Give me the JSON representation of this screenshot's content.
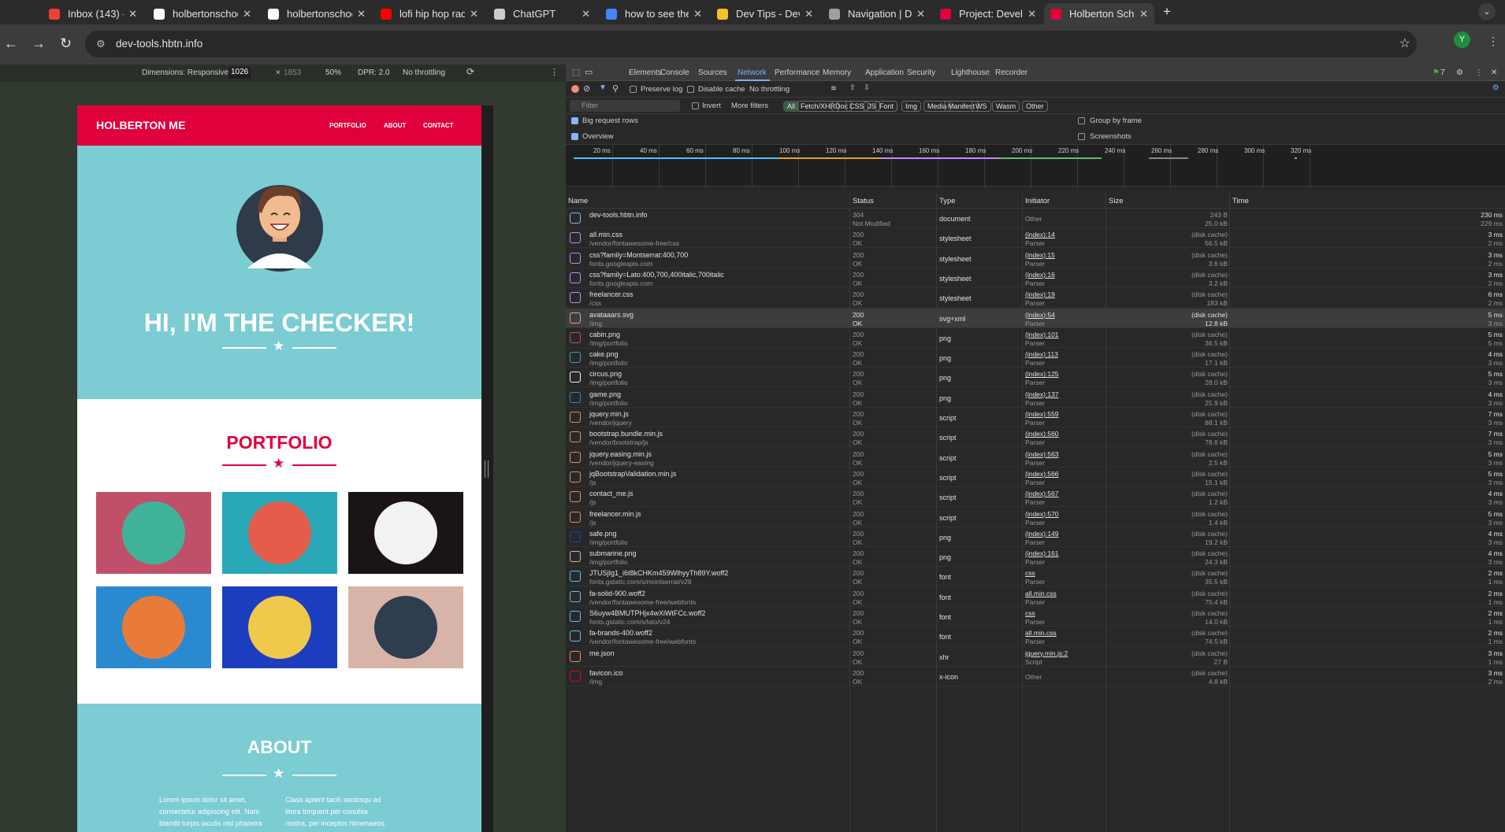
{
  "tabs": [
    {
      "title": "Inbox (143) - 630",
      "color": "#ea4335",
      "active": false
    },
    {
      "title": "holbertonschool-w",
      "color": "#ffffff",
      "active": false
    },
    {
      "title": "holbertonschool-v",
      "color": "#ffffff",
      "active": false
    },
    {
      "title": "lofi hip hop radio",
      "color": "#ff0000",
      "active": false
    },
    {
      "title": "ChatGPT",
      "color": "#cccccc",
      "active": false
    },
    {
      "title": "how to see the we",
      "color": "#4285f4",
      "active": false
    },
    {
      "title": "Dev Tips - Develo",
      "color": "#f6c026",
      "active": false
    },
    {
      "title": "Navigation | Dow",
      "color": "#9aa0a6",
      "active": false
    },
    {
      "title": "Project: Develope",
      "color": "#e0003c",
      "active": false
    },
    {
      "title": "Holberton School",
      "color": "#e0003c",
      "active": true
    }
  ],
  "address": "dev-tools.hbtn.info",
  "profile_initial": "Y",
  "device_toolbar": {
    "dimensions": "Dimensions: Responsive",
    "width": "1026",
    "times": "×",
    "height": "1853",
    "zoom": "50%",
    "dpr": "DPR: 2.0",
    "throttling": "No throttling"
  },
  "site": {
    "brand": "HOLBERTON ME",
    "nav": [
      "PORTFOLIO",
      "ABOUT",
      "CONTACT"
    ],
    "hero_title": "HI, I'M THE CHECKER!",
    "portfolio_title": "PORTFOLIO",
    "about_title": "ABOUT",
    "about_left": [
      "Lorem ipsum dolor sit amet,",
      "consectetur adipiscing elit. Nam",
      "blandit turpis iaculis nisl pharetra"
    ],
    "about_right": [
      "Class aptent taciti sociosqu ad",
      "litora torquent per conubia",
      "nostra, per inceptos himenaeos."
    ],
    "tiles": [
      {
        "name": "cabin",
        "bg": "#c0506a",
        "circle": "#3fb39a"
      },
      {
        "name": "cake",
        "bg": "#2aa8b8",
        "circle": "#e35d4a"
      },
      {
        "name": "circus",
        "bg": "#1a1414",
        "circle": "#f2f2f2"
      },
      {
        "name": "game",
        "bg": "#2a8ad0",
        "circle": "#e87b3a"
      },
      {
        "name": "safe",
        "bg": "#1d3fbf",
        "circle": "#f0c84b"
      },
      {
        "name": "submarine",
        "bg": "#d8b4a8",
        "circle": "#2c3e50"
      }
    ]
  },
  "devtools": {
    "panels": [
      "Elements",
      "Console",
      "Sources",
      "Network",
      "Performance",
      "Memory",
      "Application",
      "Security",
      "Lighthouse",
      "Recorder"
    ],
    "active_panel": "Network",
    "issues_count": "7",
    "preserve_log": "Preserve log",
    "disable_cache": "Disable cache",
    "throttle": "No throttling",
    "filter_placeholder": "Filter",
    "invert": "Invert",
    "more_filters": "More filters",
    "filter_chips": [
      "All",
      "Fetch/XHR",
      "Doc",
      "CSS",
      "JS",
      "Font",
      "Img",
      "Media",
      "Manifest",
      "WS",
      "Wasm",
      "Other"
    ],
    "big_request_rows": "Big request rows",
    "overview": "Overview",
    "group_by_frame": "Group by frame",
    "screenshots": "Screenshots",
    "ticks": [
      "20 ms",
      "40 ms",
      "60 ms",
      "80 ms",
      "100 ms",
      "120 ms",
      "140 ms",
      "160 ms",
      "180 ms",
      "200 ms",
      "220 ms",
      "240 ms",
      "260 ms",
      "280 ms",
      "300 ms",
      "320 ms"
    ],
    "columns": [
      "Name",
      "Status",
      "Type",
      "Initiator",
      "Size",
      "Time"
    ],
    "requests": [
      {
        "name": "dev-tools.hbtn.info",
        "path": "",
        "status": "304",
        "status_text": "Not Modified",
        "type": "document",
        "initiator": "Other",
        "init2": "",
        "size": "243 B",
        "size2": "25.0 kB",
        "time": "230 ms",
        "time2": "229 ms",
        "icon": "#8ab4f8"
      },
      {
        "name": "all.min.css",
        "path": "/vendor/fontawesome-free/css",
        "status": "200",
        "status_text": "OK",
        "type": "stylesheet",
        "initiator": "(index):14",
        "init2": "Parser",
        "size": "(disk cache)",
        "size2": "56.5 kB",
        "time": "3 ms",
        "time2": "2 ms",
        "icon": "#c58af9"
      },
      {
        "name": "css?family=Montserrat:400,700",
        "path": "fonts.googleapis.com",
        "status": "200",
        "status_text": "OK",
        "type": "stylesheet",
        "initiator": "(index):15",
        "init2": "Parser",
        "size": "(disk cache)",
        "size2": "3.6 kB",
        "time": "3 ms",
        "time2": "2 ms",
        "icon": "#c58af9"
      },
      {
        "name": "css?family=Lato:400,700,400italic,700italic",
        "path": "fonts.googleapis.com",
        "status": "200",
        "status_text": "OK",
        "type": "stylesheet",
        "initiator": "(index):16",
        "init2": "Parser",
        "size": "(disk cache)",
        "size2": "3.2 kB",
        "time": "3 ms",
        "time2": "2 ms",
        "icon": "#c58af9"
      },
      {
        "name": "freelancer.css",
        "path": "/css",
        "status": "200",
        "status_text": "OK",
        "type": "stylesheet",
        "initiator": "(index):19",
        "init2": "Parser",
        "size": "(disk cache)",
        "size2": "183 kB",
        "time": "6 ms",
        "time2": "2 ms",
        "icon": "#c58af9"
      },
      {
        "name": "avataaars.svg",
        "path": "/img",
        "status": "200",
        "status_text": "OK",
        "type": "svg+xml",
        "initiator": "(index):54",
        "init2": "Parser",
        "size": "(disk cache)",
        "size2": "12.8 kB",
        "time": "5 ms",
        "time2": "3 ms",
        "icon": "#e8a97c",
        "highlight": true
      },
      {
        "name": "cabin.png",
        "path": "/img/portfolio",
        "status": "200",
        "status_text": "OK",
        "type": "png",
        "initiator": "(index):101",
        "init2": "Parser",
        "size": "(disk cache)",
        "size2": "36.5 kB",
        "time": "5 ms",
        "time2": "5 ms",
        "icon": "#c0506a"
      },
      {
        "name": "cake.png",
        "path": "/img/portfolio",
        "status": "200",
        "status_text": "OK",
        "type": "png",
        "initiator": "(index):113",
        "init2": "Parser",
        "size": "(disk cache)",
        "size2": "17.1 kB",
        "time": "4 ms",
        "time2": "3 ms",
        "icon": "#2aa8b8"
      },
      {
        "name": "circus.png",
        "path": "/img/portfolio",
        "status": "200",
        "status_text": "OK",
        "type": "png",
        "initiator": "(index):125",
        "init2": "Parser",
        "size": "(disk cache)",
        "size2": "28.0 kB",
        "time": "5 ms",
        "time2": "3 ms",
        "icon": "#f2f2f2"
      },
      {
        "name": "game.png",
        "path": "/img/portfolio",
        "status": "200",
        "status_text": "OK",
        "type": "png",
        "initiator": "(index):137",
        "init2": "Parser",
        "size": "(disk cache)",
        "size2": "25.9 kB",
        "time": "4 ms",
        "time2": "3 ms",
        "icon": "#2a8ad0"
      },
      {
        "name": "jquery.min.js",
        "path": "/vendor/jquery",
        "status": "200",
        "status_text": "OK",
        "type": "script",
        "initiator": "(index):559",
        "init2": "Parser",
        "size": "(disk cache)",
        "size2": "88.1 kB",
        "time": "7 ms",
        "time2": "3 ms",
        "icon": "#ee8a5a"
      },
      {
        "name": "bootstrap.bundle.min.js",
        "path": "/vendor/bootstrap/js",
        "status": "200",
        "status_text": "OK",
        "type": "script",
        "initiator": "(index):560",
        "init2": "Parser",
        "size": "(disk cache)",
        "size2": "78.6 kB",
        "time": "7 ms",
        "time2": "3 ms",
        "icon": "#ee8a5a"
      },
      {
        "name": "jquery.easing.min.js",
        "path": "/vendor/jquery-easing",
        "status": "200",
        "status_text": "OK",
        "type": "script",
        "initiator": "(index):563",
        "init2": "Parser",
        "size": "(disk cache)",
        "size2": "2.5 kB",
        "time": "5 ms",
        "time2": "3 ms",
        "icon": "#ee8a5a"
      },
      {
        "name": "jqBootstrapValidation.min.js",
        "path": "/js",
        "status": "200",
        "status_text": "OK",
        "type": "script",
        "initiator": "(index):566",
        "init2": "Parser",
        "size": "(disk cache)",
        "size2": "15.1 kB",
        "time": "5 ms",
        "time2": "3 ms",
        "icon": "#ee8a5a"
      },
      {
        "name": "contact_me.js",
        "path": "/js",
        "status": "200",
        "status_text": "OK",
        "type": "script",
        "initiator": "(index):567",
        "init2": "Parser",
        "size": "(disk cache)",
        "size2": "1.2 kB",
        "time": "4 ms",
        "time2": "3 ms",
        "icon": "#ee8a5a"
      },
      {
        "name": "freelancer.min.js",
        "path": "/js",
        "status": "200",
        "status_text": "OK",
        "type": "script",
        "initiator": "(index):570",
        "init2": "Parser",
        "size": "(disk cache)",
        "size2": "1.4 kB",
        "time": "5 ms",
        "time2": "3 ms",
        "icon": "#ee8a5a"
      },
      {
        "name": "safe.png",
        "path": "/img/portfolio",
        "status": "200",
        "status_text": "OK",
        "type": "png",
        "initiator": "(index):149",
        "init2": "Parser",
        "size": "(disk cache)",
        "size2": "19.2 kB",
        "time": "4 ms",
        "time2": "3 ms",
        "icon": "#1d3fbf"
      },
      {
        "name": "submarine.png",
        "path": "/img/portfolio",
        "status": "200",
        "status_text": "OK",
        "type": "png",
        "initiator": "(index):161",
        "init2": "Parser",
        "size": "(disk cache)",
        "size2": "24.3 kB",
        "time": "4 ms",
        "time2": "3 ms",
        "icon": "#d8b4a8"
      },
      {
        "name": "JTUSjIg1_i6t8kCHKm459WlhyyTh89Y.woff2",
        "path": "fonts.gstatic.com/s/montserrat/v29",
        "status": "200",
        "status_text": "OK",
        "type": "font",
        "initiator": "css",
        "init2": "Parser",
        "size": "(disk cache)",
        "size2": "35.5 kB",
        "time": "2 ms",
        "time2": "1 ms",
        "icon": "#4fc3f7"
      },
      {
        "name": "fa-solid-900.woff2",
        "path": "/vendor/fontawesome-free/webfonts",
        "status": "200",
        "status_text": "OK",
        "type": "font",
        "initiator": "all.min.css",
        "init2": "Parser",
        "size": "(disk cache)",
        "size2": "75.4 kB",
        "time": "2 ms",
        "time2": "1 ms",
        "icon": "#4fc3f7"
      },
      {
        "name": "S6uyw4BMUTPHjx4wXiWtFCc.woff2",
        "path": "fonts.gstatic.com/s/lato/v24",
        "status": "200",
        "status_text": "OK",
        "type": "font",
        "initiator": "css",
        "init2": "Parser",
        "size": "(disk cache)",
        "size2": "14.0 kB",
        "time": "2 ms",
        "time2": "1 ms",
        "icon": "#4fc3f7"
      },
      {
        "name": "fa-brands-400.woff2",
        "path": "/vendor/fontawesome-free/webfonts",
        "status": "200",
        "status_text": "OK",
        "type": "font",
        "initiator": "all.min.css",
        "init2": "Parser",
        "size": "(disk cache)",
        "size2": "74.5 kB",
        "time": "2 ms",
        "time2": "1 ms",
        "icon": "#4fc3f7"
      },
      {
        "name": "me.json",
        "path": "",
        "status": "200",
        "status_text": "OK",
        "type": "xhr",
        "initiator": "jquery.min.js:2",
        "init2": "Script",
        "size": "(disk cache)",
        "size2": "27 B",
        "time": "3 ms",
        "time2": "1 ms",
        "icon": "#ee8a5a"
      },
      {
        "name": "favicon.ico",
        "path": "/img",
        "status": "200",
        "status_text": "OK",
        "type": "x-icon",
        "initiator": "Other",
        "init2": "",
        "size": "(disk cache)",
        "size2": "4.8 kB",
        "time": "3 ms",
        "time2": "2 ms",
        "icon": "#e0003c"
      }
    ]
  }
}
